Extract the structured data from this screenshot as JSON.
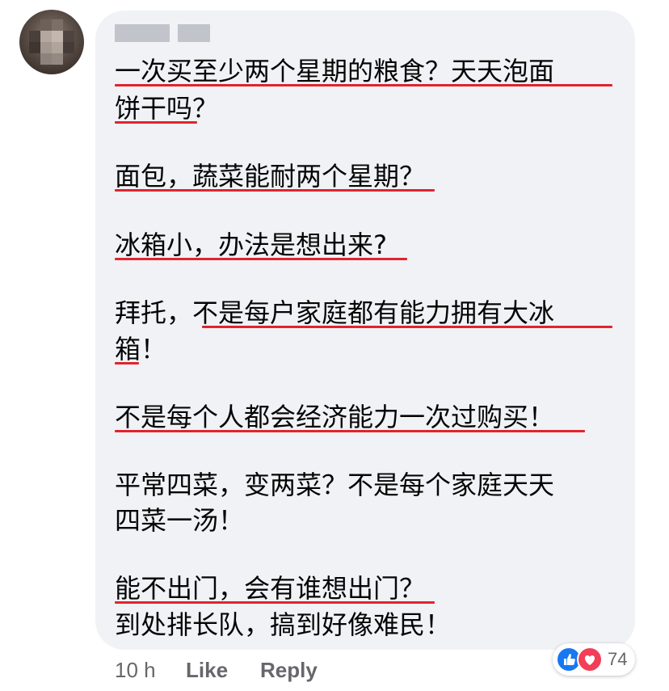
{
  "comment": {
    "lines": [
      "一次买至少两个星期的粮食？天天泡面",
      "饼干吗？",
      "面包，蔬菜能耐两个星期？",
      "冰箱小，办法是想出来?",
      "拜托，不是每户家庭都有能力拥有大冰",
      "箱！",
      "不是每个人都会经济能力一次过购买！",
      "平常四菜，变两菜？不是每个家庭天天",
      "四菜一汤！",
      "能不出门，会有谁想出门？",
      "到处排长队，搞到好像难民！"
    ]
  },
  "footer": {
    "time": "10 h",
    "like_label": "Like",
    "reply_label": "Reply"
  },
  "reactions": {
    "count": "74",
    "icons": [
      "thumbs-up-icon",
      "heart-icon"
    ],
    "like_color": "#1877f2",
    "love_color": "#f33e58"
  },
  "colors": {
    "bubble": "#f0f2f5",
    "underline": "#e0242e",
    "meta_text": "#65676b"
  }
}
